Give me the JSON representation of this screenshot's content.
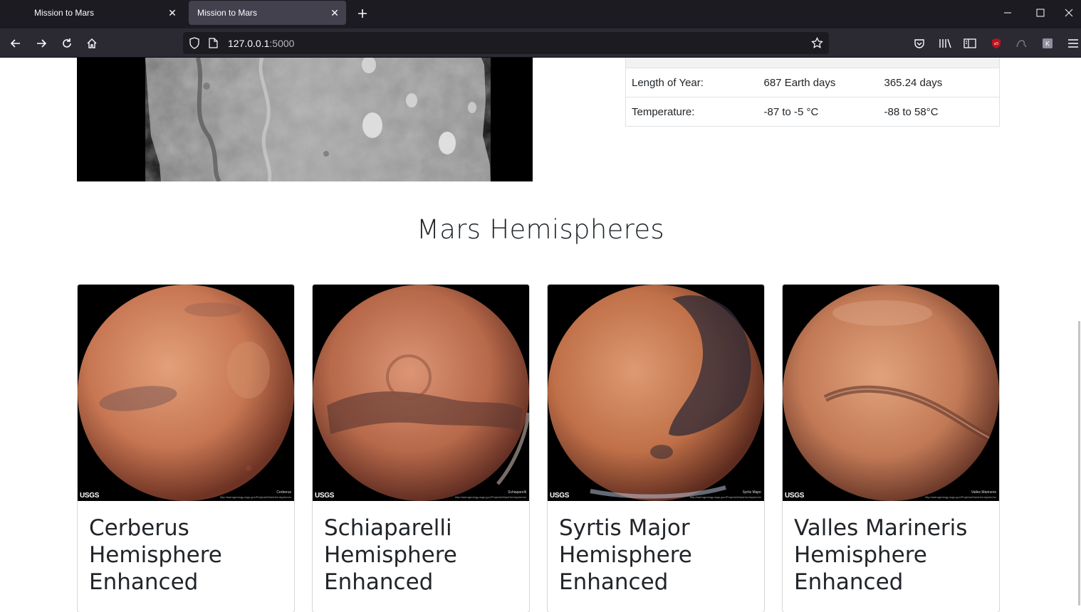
{
  "browser": {
    "tabs": [
      {
        "title": "Mission to Mars",
        "active": false
      },
      {
        "title": "Mission to Mars",
        "active": true
      }
    ],
    "url_host": "127.0.0.1",
    "url_port": ":5000"
  },
  "facts_table": {
    "rows": [
      {
        "label": "Length of Year:",
        "mars": "687 Earth days",
        "earth": "365.24 days"
      },
      {
        "label": "Temperature:",
        "mars": "-87 to -5 °C",
        "earth": "-88 to 58°C"
      }
    ]
  },
  "hemispheres": {
    "heading": "Mars Hemispheres",
    "items": [
      {
        "title": "Cerberus Hemisphere Enhanced",
        "caption": "Cerberus",
        "logo": "USGS",
        "url_fine": "http://astrogeology.usgs.gov/Projects/MarsHemispheres/"
      },
      {
        "title": "Schiaparelli Hemisphere Enhanced",
        "caption": "Schiaparelli",
        "logo": "USGS",
        "url_fine": "http://astrogeology.usgs.gov/Projects/MarsHemispheres/"
      },
      {
        "title": "Syrtis Major Hemisphere Enhanced",
        "caption": "Syrtis Major",
        "logo": "USGS",
        "url_fine": "http://astrogeology.usgs.gov/Projects/MarsHemispheres/"
      },
      {
        "title": "Valles Marineris Hemisphere Enhanced",
        "caption": "Valles Marineris",
        "logo": "USGS",
        "url_fine": "http://astrogeology.usgs.gov/Projects/MarsHemispheres/"
      }
    ]
  },
  "colors": {
    "chrome_dark": "#1c1b22",
    "toolbar": "#2b2a33",
    "mars_light": "#d98a66",
    "mars_dark": "#5a2d22"
  }
}
